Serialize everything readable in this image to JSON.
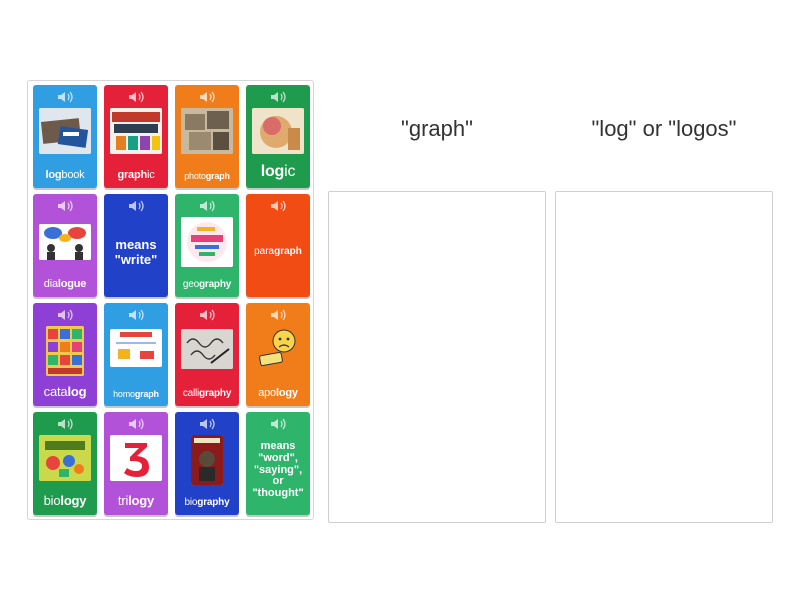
{
  "buckets": [
    {
      "title": "\"graph\""
    },
    {
      "title": "\"log\" or \"logos\""
    }
  ],
  "cards": [
    {
      "id": "logbook",
      "color": "#2f9ee3",
      "parts": [
        [
          "log",
          true
        ],
        [
          "book",
          false
        ]
      ],
      "icon": "logbook-image"
    },
    {
      "id": "graphic",
      "color": "#e5213a",
      "parts": [
        [
          "graph",
          true
        ],
        [
          "ic",
          false
        ]
      ],
      "icon": "graphic-novels-image"
    },
    {
      "id": "photograph",
      "color": "#f07d1a",
      "parts": [
        [
          "photo",
          false
        ],
        [
          "graph",
          true
        ]
      ],
      "icon": "old-photographs-image"
    },
    {
      "id": "logic",
      "color": "#1f9b4e",
      "parts": [
        [
          "log",
          true
        ],
        [
          "ic",
          false
        ]
      ],
      "icon": "thinking-head-image"
    },
    {
      "id": "dialogue",
      "color": "#b252d8",
      "parts": [
        [
          "dia",
          false
        ],
        [
          "logue",
          true
        ]
      ],
      "icon": "speech-bubbles-image"
    },
    {
      "id": "means-write",
      "color": "#2141c8",
      "text": "means \"write\""
    },
    {
      "id": "geography",
      "color": "#2fb56b",
      "parts": [
        [
          "geo",
          false
        ],
        [
          "graphy",
          true
        ]
      ],
      "icon": "geography-wordcloud-image"
    },
    {
      "id": "paragraph",
      "color": "#f24c15",
      "parts": [
        [
          "para",
          false
        ],
        [
          "graph",
          true
        ]
      ]
    },
    {
      "id": "catalog",
      "color": "#8d3fd6",
      "parts": [
        [
          "cata",
          false
        ],
        [
          "log",
          true
        ]
      ],
      "icon": "catalog-image"
    },
    {
      "id": "homograph",
      "color": "#2f9ee3",
      "parts": [
        [
          "homo",
          false
        ],
        [
          "graph",
          true
        ]
      ],
      "icon": "homograph-image"
    },
    {
      "id": "calligraphy",
      "color": "#e5213a",
      "parts": [
        [
          "calli",
          false
        ],
        [
          "graphy",
          true
        ]
      ],
      "icon": "calligraphy-image"
    },
    {
      "id": "apology",
      "color": "#f07d1a",
      "parts": [
        [
          "apo",
          false
        ],
        [
          "logy",
          true
        ]
      ],
      "icon": "sorry-face-image"
    },
    {
      "id": "biology",
      "color": "#1f9b4e",
      "parts": [
        [
          "bio",
          false
        ],
        [
          "logy",
          true
        ]
      ],
      "icon": "biology-book-image"
    },
    {
      "id": "trilogy",
      "color": "#b252d8",
      "parts": [
        [
          "tri",
          false
        ],
        [
          "logy",
          true
        ]
      ],
      "icon": "number-three-image"
    },
    {
      "id": "biography",
      "color": "#2141c8",
      "parts": [
        [
          "bio",
          false
        ],
        [
          "graphy",
          true
        ]
      ],
      "icon": "lincoln-book-image"
    },
    {
      "id": "means-word",
      "color": "#2fb56b",
      "text": "means \"word\", \"saying\", or \"thought\""
    }
  ]
}
